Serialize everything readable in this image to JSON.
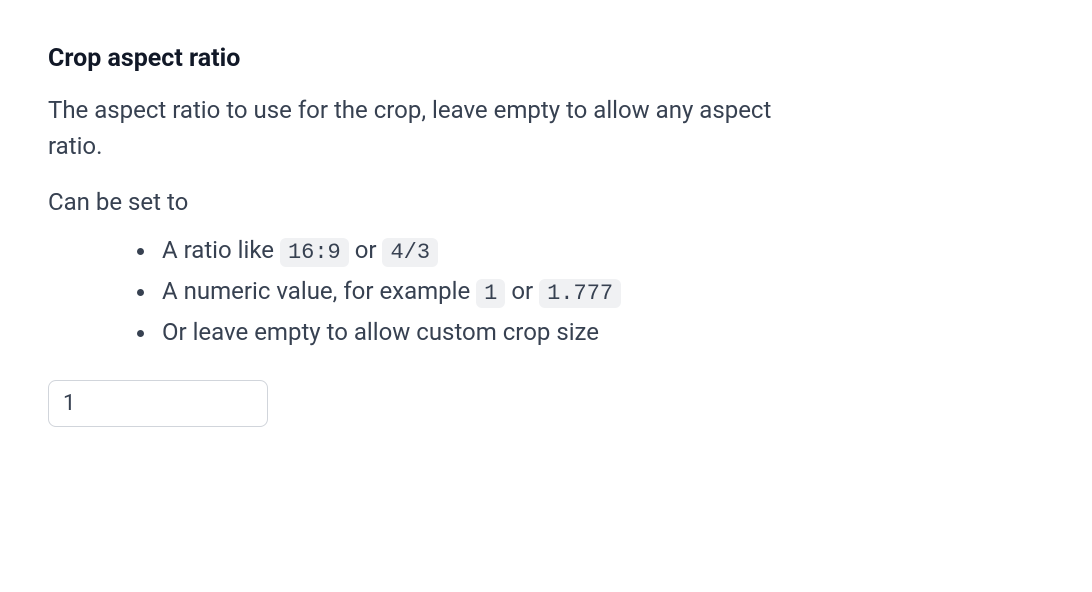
{
  "section": {
    "heading": "Crop aspect ratio",
    "description": "The aspect ratio to use for the crop, leave empty to allow any aspect ratio.",
    "lead": "Can be set to",
    "items": {
      "item1_prefix": "A ratio like ",
      "item1_code1": "16:9",
      "item1_mid": " or ",
      "item1_code2": "4/3",
      "item2_prefix": "A numeric value, for example ",
      "item2_code1": "1",
      "item2_mid": " or ",
      "item2_code2": "1.777",
      "item3_text": "Or leave empty to allow custom crop size"
    },
    "input_value": "1"
  }
}
